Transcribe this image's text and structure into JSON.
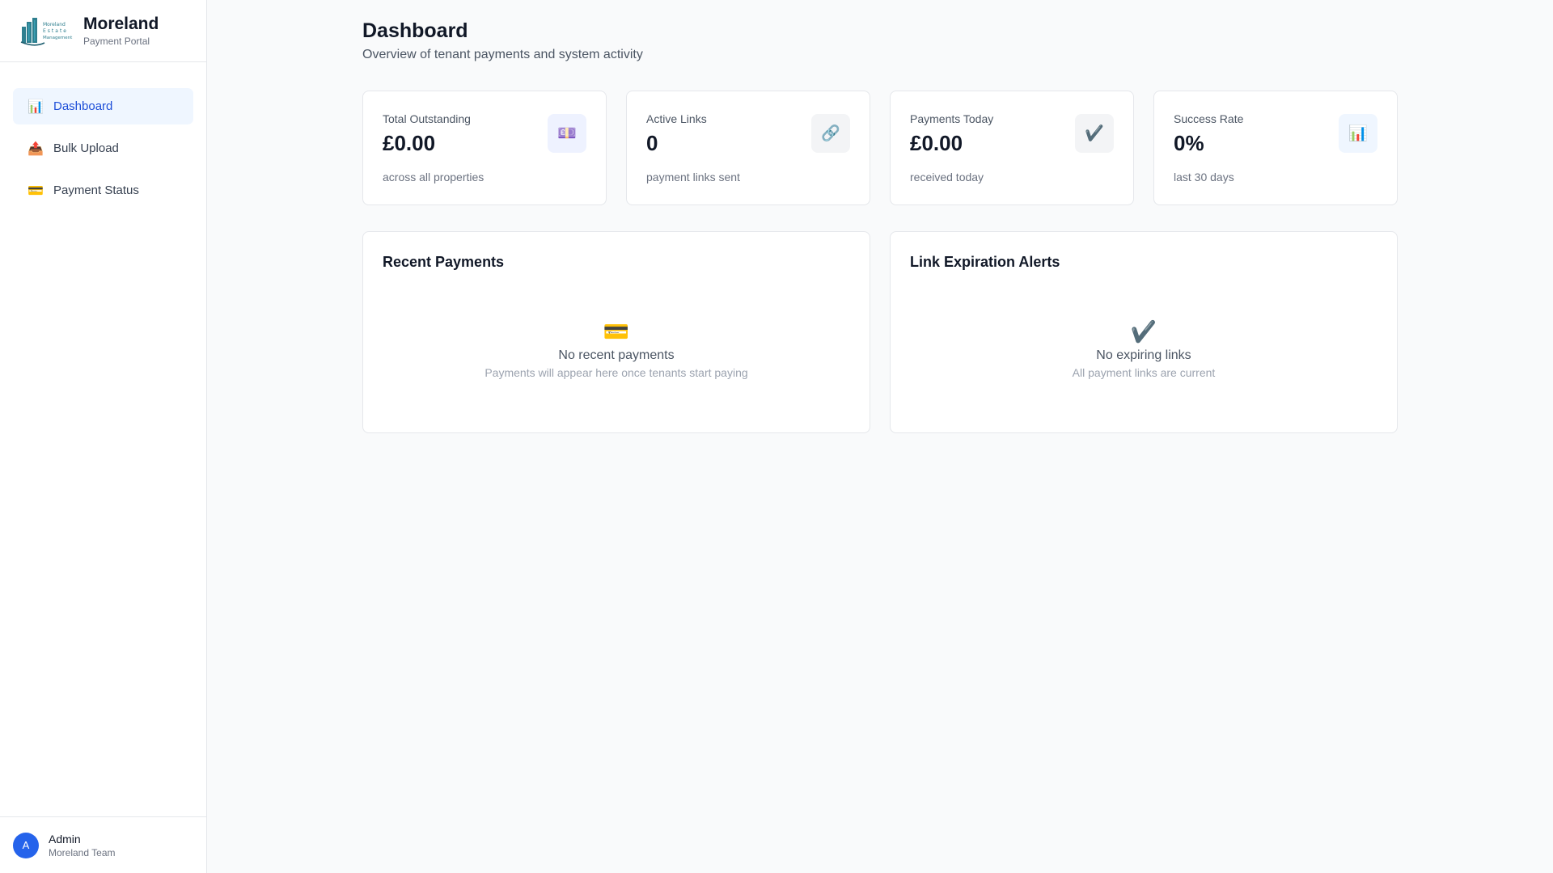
{
  "sidebar": {
    "brand": {
      "title": "Moreland",
      "subtitle": "Payment Portal",
      "logo_lines": [
        "Moreland",
        "Estate",
        "Management"
      ]
    },
    "nav": [
      {
        "label": "Dashboard",
        "icon": "📊",
        "icon_name": "bar-chart-icon",
        "active": true
      },
      {
        "label": "Bulk Upload",
        "icon": "📤",
        "icon_name": "upload-icon",
        "active": false
      },
      {
        "label": "Payment Status",
        "icon": "💳",
        "icon_name": "credit-card-icon",
        "active": false
      }
    ],
    "user": {
      "initial": "A",
      "name": "Admin",
      "team": "Moreland Team"
    }
  },
  "header": {
    "title": "Dashboard",
    "subtitle": "Overview of tenant payments and system activity"
  },
  "stats": [
    {
      "label": "Total Outstanding",
      "value": "£0.00",
      "note": "across all properties",
      "icon": "💷",
      "icon_name": "pound-note-icon",
      "icon_bg": "#eef2ff"
    },
    {
      "label": "Active Links",
      "value": "0",
      "note": "payment links sent",
      "icon": "🔗",
      "icon_name": "link-icon",
      "icon_bg": "#f3f4f6"
    },
    {
      "label": "Payments Today",
      "value": "£0.00",
      "note": "received today",
      "icon": "✔️",
      "icon_name": "check-icon",
      "icon_bg": "#f3f4f6"
    },
    {
      "label": "Success Rate",
      "value": "0%",
      "note": "last 30 days",
      "icon": "📊",
      "icon_name": "bar-chart-icon",
      "icon_bg": "#eff6ff"
    }
  ],
  "panels": {
    "recent_payments": {
      "title": "Recent Payments",
      "empty_icon": "💳",
      "empty_title": "No recent payments",
      "empty_sub": "Payments will appear here once tenants start paying"
    },
    "link_alerts": {
      "title": "Link Expiration Alerts",
      "empty_icon": "✔️",
      "empty_title": "No expiring links",
      "empty_sub": "All payment links are current"
    }
  },
  "colors": {
    "accent": "#2563eb",
    "active_nav_bg": "#eff6ff",
    "active_nav_text": "#1d4ed8",
    "page_bg": "#f9fafb"
  }
}
